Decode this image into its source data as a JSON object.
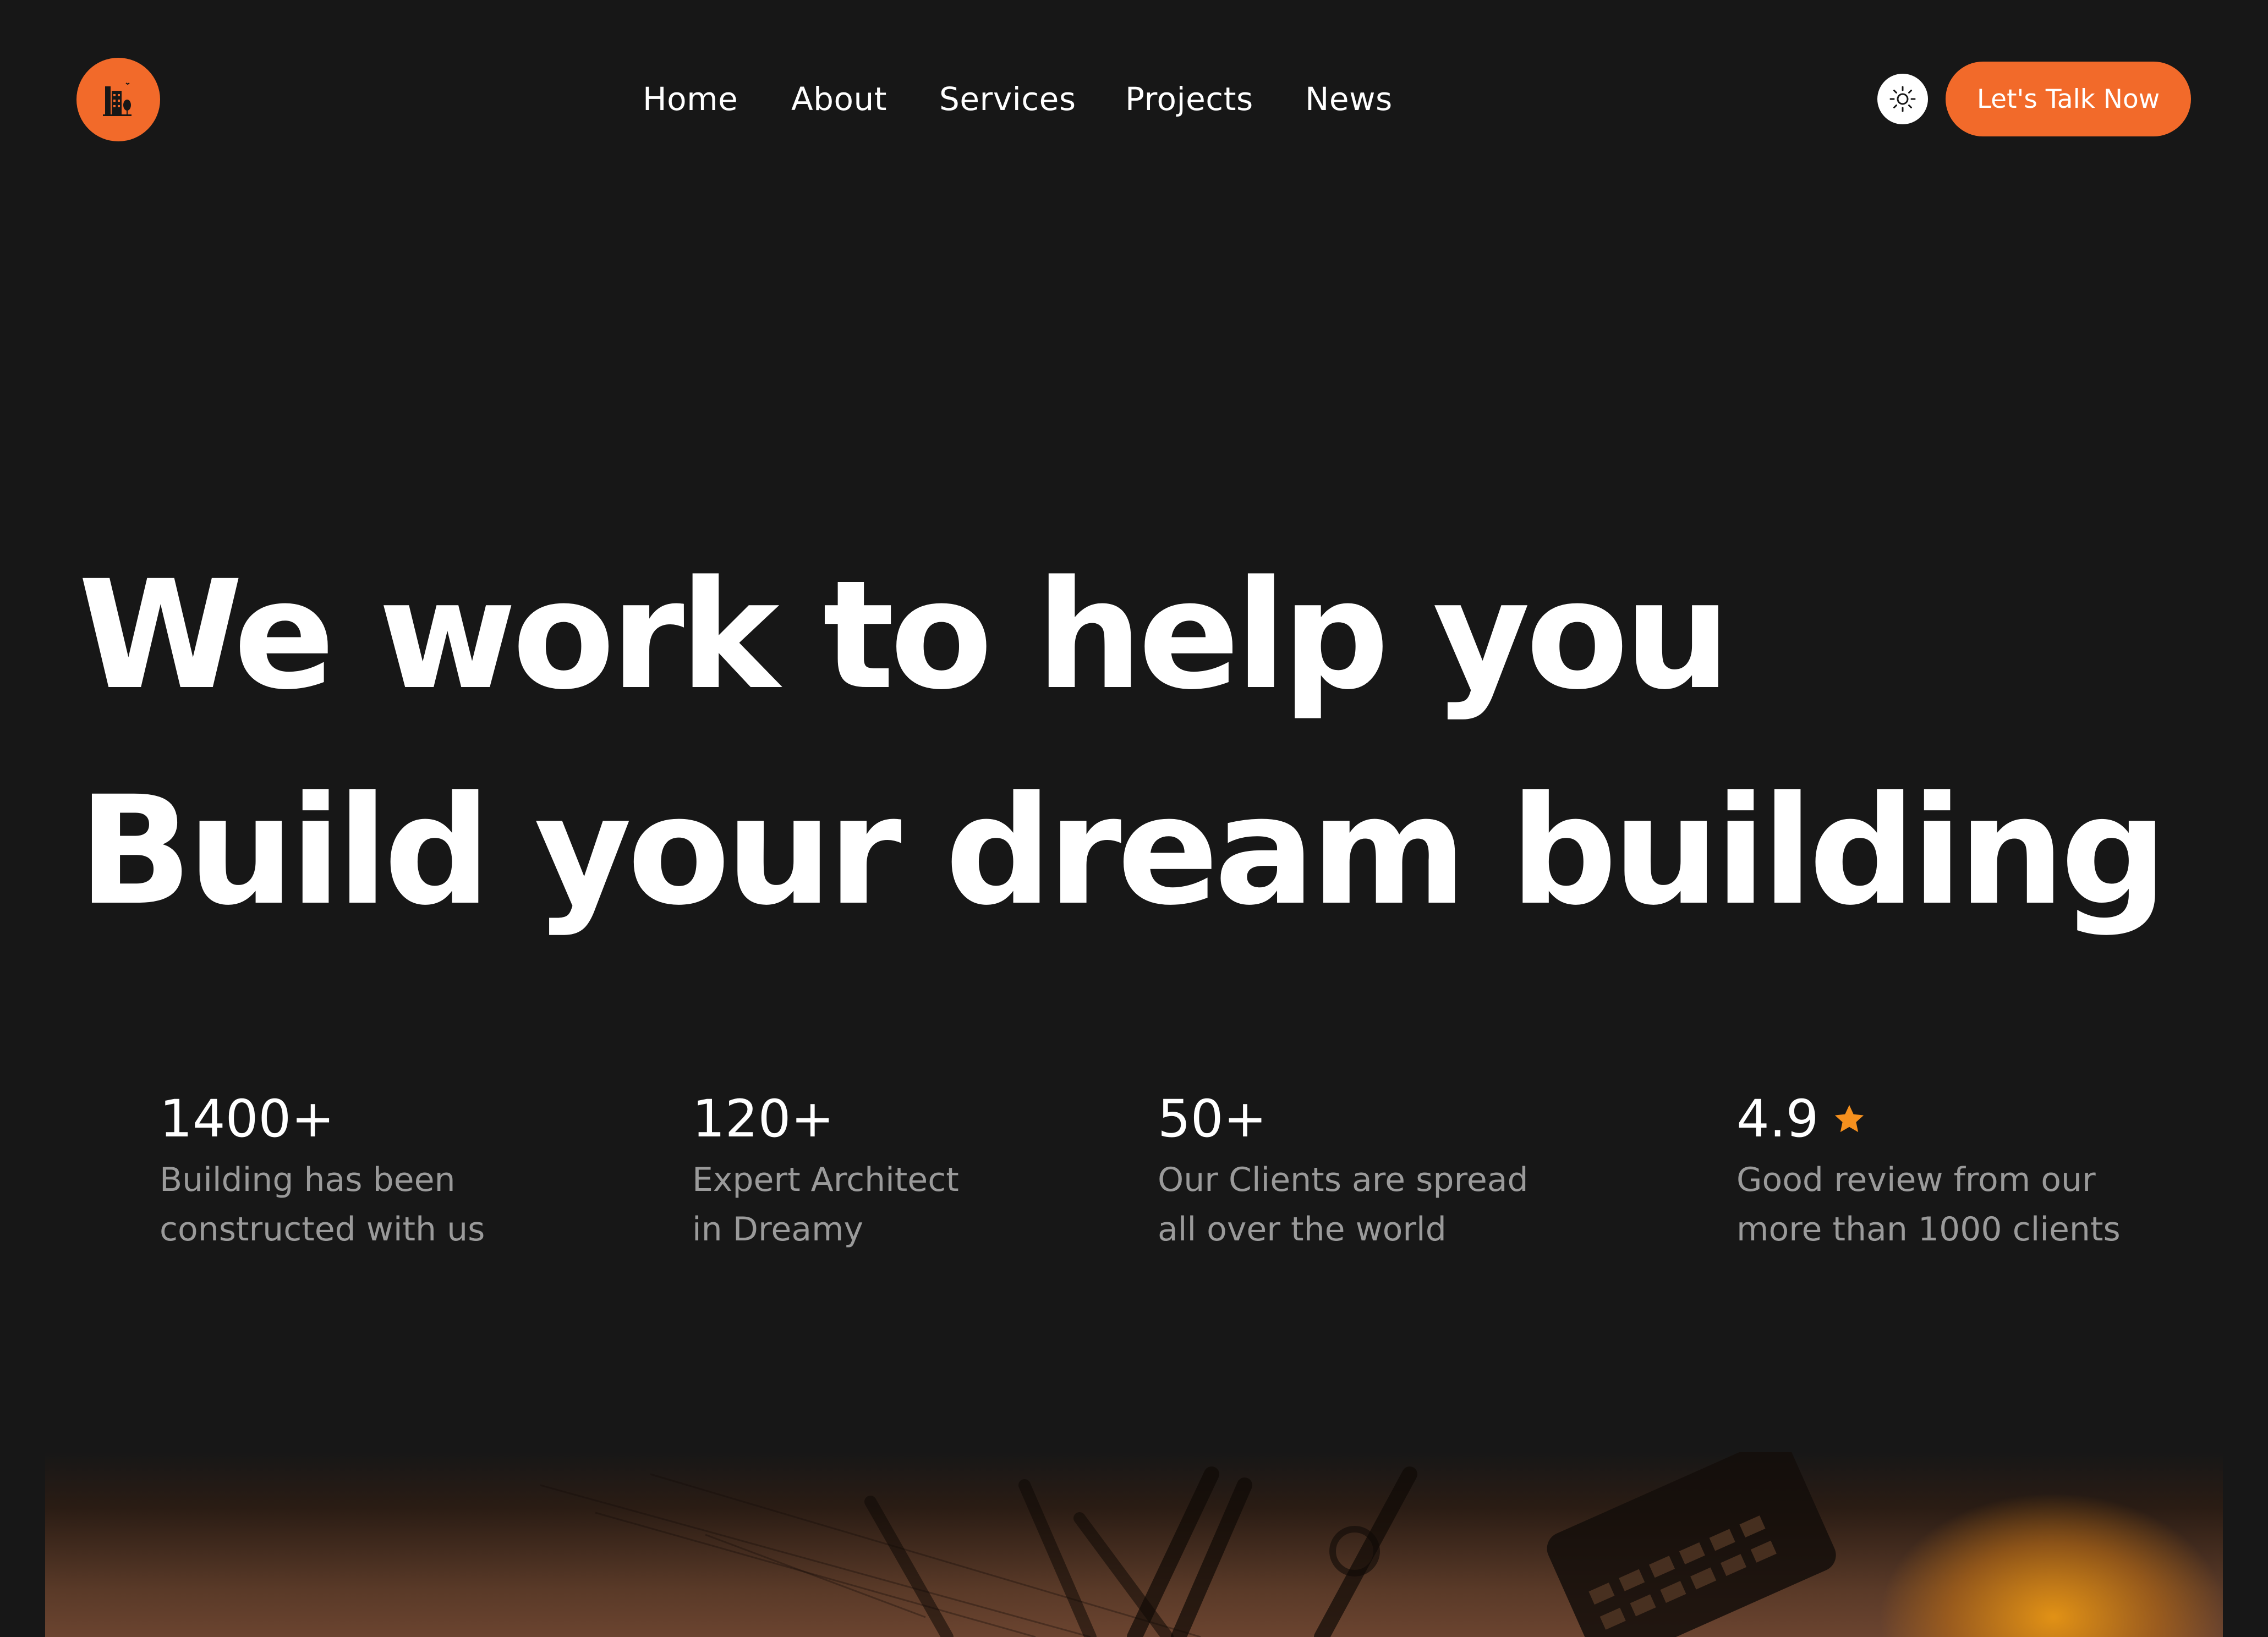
{
  "header": {
    "logo_icon": "building-logo-icon",
    "nav": {
      "home": "Home",
      "about": "About",
      "services": "Services",
      "projects": "Projects",
      "news": "News"
    },
    "theme_icon": "sun-icon",
    "cta_label": "Let's Talk Now"
  },
  "hero": {
    "line1": "We work to help you",
    "line2": "Build your dream building"
  },
  "stats": {
    "buildings": {
      "value": "1400+",
      "line1": "Building has been",
      "line2": "constructed with us"
    },
    "architects": {
      "value": "120+",
      "line1": "Expert Architect",
      "line2": "in Dreamy"
    },
    "clients": {
      "value": "50+",
      "line1": "Our Clients are spread",
      "line2": "all over the world"
    },
    "rating": {
      "value": "4.9",
      "icon": "star-icon",
      "line1": "Good review from our",
      "line2": "more than 1000 clients"
    }
  },
  "colors": {
    "background": "#171717",
    "accent": "#F26A2A",
    "text": "#FFFFFF",
    "muted_text": "#9A9A9A",
    "star": "#F5901E"
  }
}
